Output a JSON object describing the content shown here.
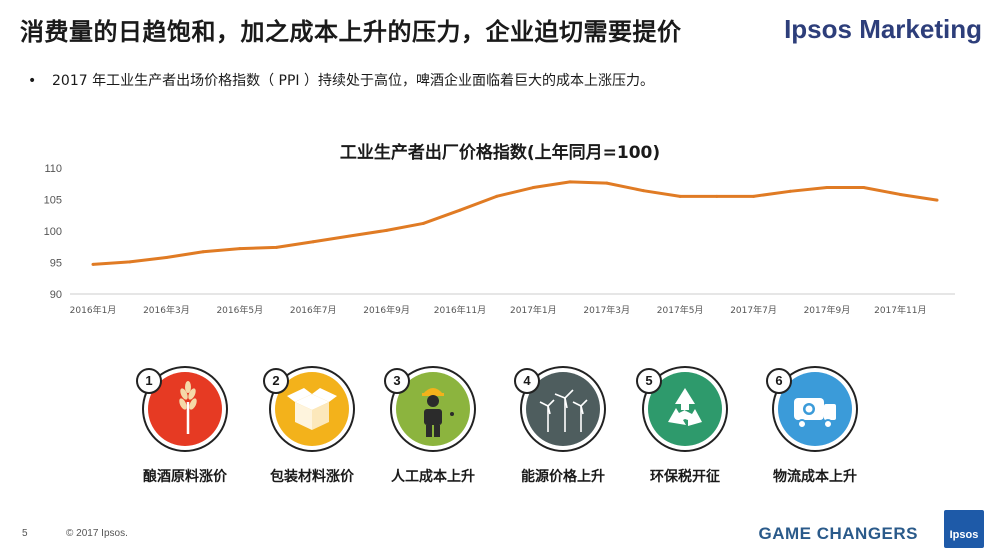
{
  "header": {
    "title": "消费量的日趋饱和，加之成本上升的压力，企业迫切需要提价",
    "brand": "Ipsos Marketing"
  },
  "bullet": {
    "marker": "•",
    "text": "2017 年工业生产者出场价格指数（ PPI ）持续处于高位，啤酒企业面临着巨大的成本上涨压力。"
  },
  "chart_data": {
    "type": "line",
    "title": "工业生产者出厂价格指数(上年同月=100)",
    "x": [
      "2016年1月",
      "2016年2月",
      "2016年3月",
      "2016年4月",
      "2016年5月",
      "2016年6月",
      "2016年7月",
      "2016年8月",
      "2016年9月",
      "2016年10月",
      "2016年11月",
      "2016年12月",
      "2017年1月",
      "2017年2月",
      "2017年3月",
      "2017年4月",
      "2017年5月",
      "2017年6月",
      "2017年7月",
      "2017年8月",
      "2017年9月",
      "2017年10月",
      "2017年11月",
      "2017年12月"
    ],
    "tick_labels": [
      "2016年1月",
      "2016年3月",
      "2016年5月",
      "2016年7月",
      "2016年9月",
      "2016年11月",
      "2017年1月",
      "2017年3月",
      "2017年5月",
      "2017年7月",
      "2017年9月",
      "2017年11月"
    ],
    "series": [
      {
        "values": [
          94.7,
          95.1,
          95.8,
          96.7,
          97.2,
          97.4,
          98.3,
          99.2,
          100.1,
          101.2,
          103.3,
          105.5,
          106.9,
          107.8,
          107.6,
          106.4,
          105.5,
          105.5,
          105.5,
          106.3,
          106.9,
          106.9,
          105.8,
          104.9
        ]
      }
    ],
    "y_ticks": [
      90,
      95,
      100,
      105,
      110
    ],
    "ylim": [
      90,
      110
    ],
    "grid": false,
    "line_color": "#e07b24"
  },
  "icons": [
    {
      "num": "1",
      "icon": "wheat-icon",
      "label": "酿酒原料涨价",
      "color": "#e63a23"
    },
    {
      "num": "2",
      "icon": "box-icon",
      "label": "包装材料涨价",
      "color": "#f3b21b"
    },
    {
      "num": "3",
      "icon": "worker-icon",
      "label": "人工成本上升",
      "color": "#8cb43e"
    },
    {
      "num": "4",
      "icon": "wind-turbine-icon",
      "label": "能源价格上升",
      "color": "#4e5d5e"
    },
    {
      "num": "5",
      "icon": "recycle-icon",
      "label": "环保税开征",
      "color": "#2e9a6c"
    },
    {
      "num": "6",
      "icon": "truck-icon",
      "label": "物流成本上升",
      "color": "#3b9bd9"
    }
  ],
  "footer": {
    "page": "5",
    "copyright": "© 2017 Ipsos.",
    "tagline": "GAME CHANGERS",
    "logo": "Ipsos"
  }
}
